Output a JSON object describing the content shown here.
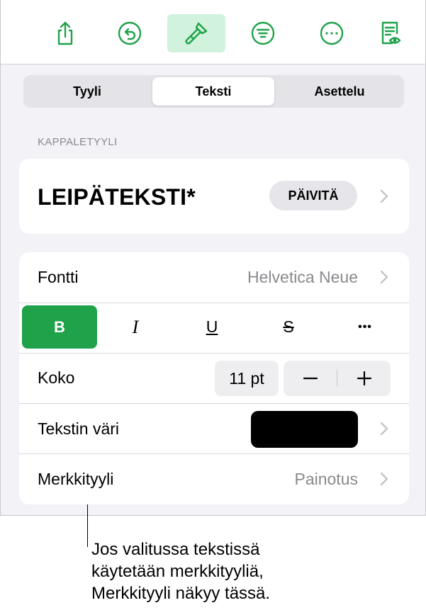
{
  "toolbar": {
    "buttons": [
      {
        "icon": "share-icon",
        "active": false
      },
      {
        "icon": "undo-icon",
        "active": false
      },
      {
        "icon": "format-brush-icon",
        "active": true
      },
      {
        "icon": "filter-icon",
        "active": false
      },
      {
        "icon": "more-icon",
        "active": false
      },
      {
        "icon": "document-view-icon",
        "active": false
      }
    ]
  },
  "tabs": [
    {
      "label": "Tyyli",
      "selected": false
    },
    {
      "label": "Teksti",
      "selected": true
    },
    {
      "label": "Asettelu",
      "selected": false
    }
  ],
  "paragraph_style": {
    "section_label": "KAPPALETYYLI",
    "name": "LEIPÄTEKSTI*",
    "update_label": "PÄIVITÄ"
  },
  "font": {
    "label": "Fontti",
    "value": "Helvetica Neue"
  },
  "formatting": {
    "bold": "B",
    "italic": "I",
    "underline": "U",
    "strikethrough": "S",
    "more": "•••",
    "bold_active": true
  },
  "size": {
    "label": "Koko",
    "value": "11 pt"
  },
  "text_color": {
    "label": "Tekstin väri",
    "color": "#000000"
  },
  "character_style": {
    "label": "Merkkityyli",
    "value": "Painotus"
  },
  "callout": {
    "lines": [
      "Jos valitussa tekstissä",
      "käytetään merkkityyliä,",
      "Merkkityyli näkyy tässä."
    ]
  },
  "colors": {
    "accent": "#1fa24a",
    "accent_light": "#d1f2dd",
    "panel_bg": "#f2f2f7",
    "secondary_text": "#8a8a8e"
  }
}
